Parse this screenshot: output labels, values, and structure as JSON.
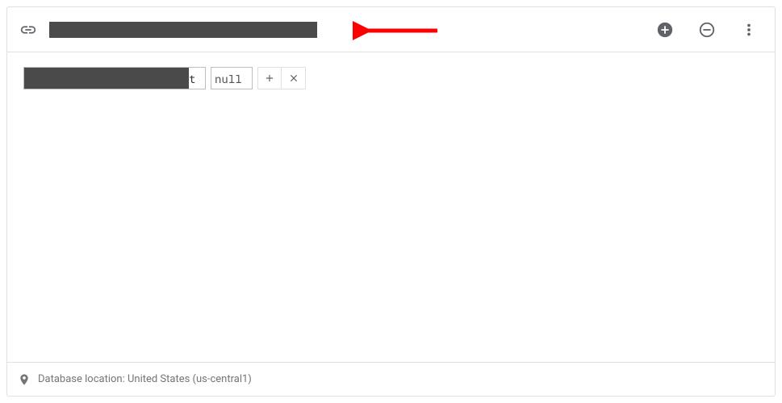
{
  "header": {
    "url_text": "",
    "url_redacted": true
  },
  "toolbar": {
    "add_label": "Add",
    "remove_label": "Remove",
    "menu_label": "More options"
  },
  "editor": {
    "key_text": "",
    "key_redacted": true,
    "key_tail": "t",
    "value": "null",
    "add_child_label": "Add child",
    "cancel_label": "Cancel"
  },
  "footer": {
    "location_text": "Database location: United States (us-central1)"
  },
  "annotation": {
    "color": "#ff0000"
  }
}
